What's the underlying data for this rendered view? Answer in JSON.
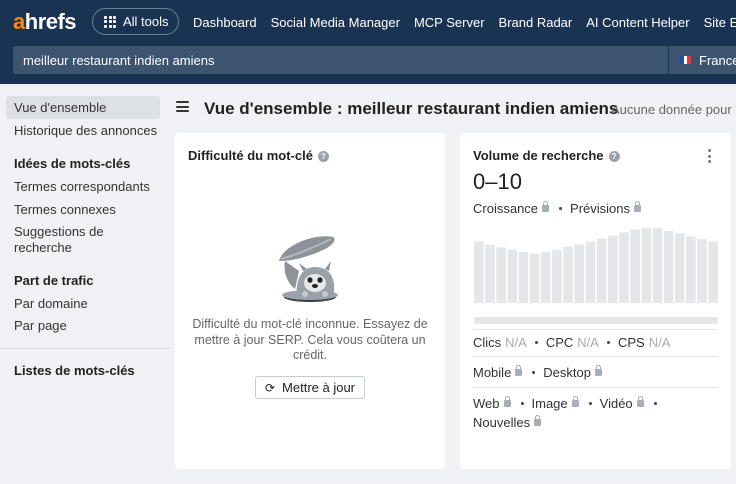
{
  "nav": {
    "logo_a": "a",
    "logo_rest": "hrefs",
    "all_tools": "All tools",
    "links": [
      "Dashboard",
      "Social Media Manager",
      "MCP Server",
      "Brand Radar",
      "AI Content Helper",
      "Site Expl"
    ]
  },
  "search": {
    "value": "meilleur restaurant indien amiens",
    "country": "France"
  },
  "sidebar": {
    "overview": "Vue d'ensemble",
    "ads_history": "Historique des annonces",
    "keyword_ideas_head": "Idées de mots-clés",
    "matching_terms": "Termes correspondants",
    "related_terms": "Termes connexes",
    "search_suggestions_l1": "Suggestions de",
    "search_suggestions_l2": "recherche",
    "traffic_share_head": "Part de trafic",
    "by_domain": "Par domaine",
    "by_page": "Par page",
    "keyword_lists": "Listes de mots-clés"
  },
  "header": {
    "title": "Vue d'ensemble : meilleur restaurant indien amiens",
    "no_data": "Aucune donnée pour c"
  },
  "kd_card": {
    "title": "Difficulté du mot-clé",
    "message": "Difficulté du mot-clé inconnue. Essayez de mettre à jour SERP. Cela vous coûtera un crédit.",
    "button": "Mettre à jour"
  },
  "volume_card": {
    "title": "Volume de recherche",
    "value": "0–10",
    "growth": "Croissance",
    "forecast": "Prévisions",
    "clicks": "Clics",
    "clicks_val": "N/A",
    "cpc": "CPC",
    "cpc_val": "N/A",
    "cps": "CPS",
    "cps_val": "N/A",
    "mobile": "Mobile",
    "desktop": "Desktop",
    "web": "Web",
    "image": "Image",
    "video": "Vidéo",
    "news": "Nouvelles",
    "bar_color": "#e4e6e9",
    "trend_levels": [
      0.82,
      0.78,
      0.74,
      0.71,
      0.68,
      0.66,
      0.68,
      0.71,
      0.75,
      0.78,
      0.82,
      0.86,
      0.9,
      0.94,
      0.98,
      1.0,
      1.0,
      0.96,
      0.93,
      0.89,
      0.85,
      0.82
    ]
  }
}
